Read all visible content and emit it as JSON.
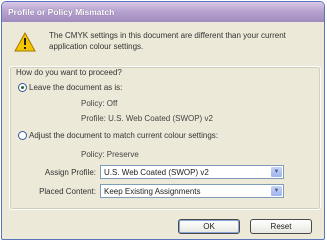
{
  "dialog": {
    "title": "Profile or Policy Mismatch",
    "message": "The CMYK settings in this document are different than your current application colour settings."
  },
  "group": {
    "title": "How do you want to proceed?",
    "leave": {
      "label": "Leave the document as is:",
      "checked": true,
      "policy": "Policy: Off",
      "profile": "Profile: U.S. Web Coated (SWOP) v2"
    },
    "adjust": {
      "label": "Adjust the document to match current colour settings:",
      "checked": false,
      "policy": "Policy: Preserve",
      "assign_profile_label": "Assign Profile:",
      "assign_profile_value": "U.S. Web Coated (SWOP) v2",
      "placed_content_label": "Placed Content:",
      "placed_content_value": "Keep Existing Assignments"
    }
  },
  "buttons": {
    "ok": "OK",
    "reset": "Reset"
  },
  "icons": {
    "warning": "warning-icon",
    "dropdown": "chevron-down-icon"
  },
  "colors": {
    "title_bar": "#b7a3cf",
    "dialog_bg": "#ece9d8",
    "warning_yellow": "#f5c400"
  }
}
